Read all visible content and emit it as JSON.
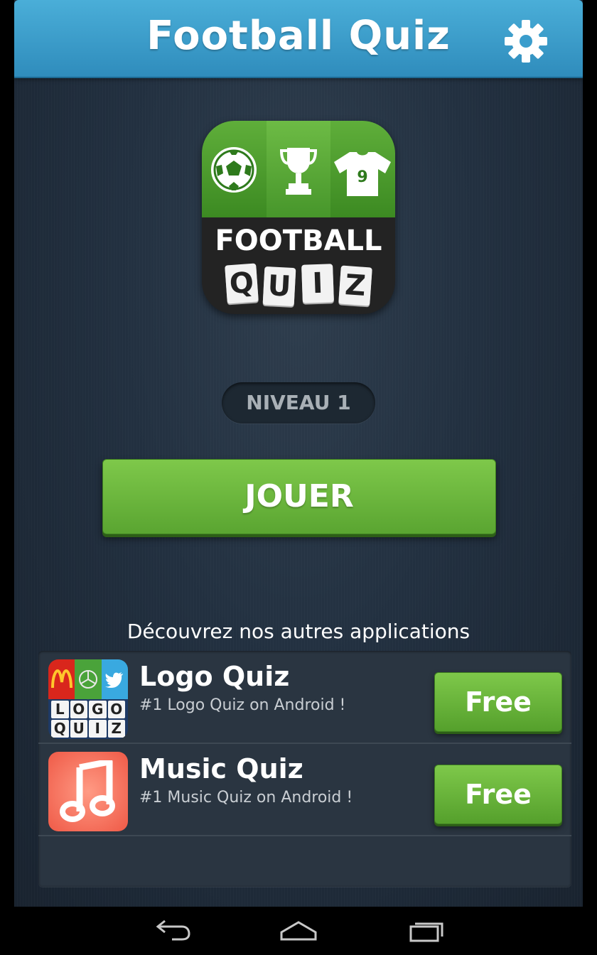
{
  "header": {
    "title": "Football Quiz"
  },
  "main_icon": {
    "word": "FOOTBALL",
    "tiles": [
      "Q",
      "U",
      "I",
      "Z"
    ],
    "jersey_number": "9"
  },
  "level": {
    "label": "NIVEAU 1"
  },
  "play_button": {
    "label": "JOUER"
  },
  "discover": {
    "title": "Découvrez nos autres applications"
  },
  "apps": [
    {
      "name": "Logo Quiz",
      "description": "#1 Logo Quiz on Android !",
      "button": "Free",
      "icon": "logo-quiz-icon",
      "icon_letters": [
        "L",
        "O",
        "G",
        "O",
        "Q",
        "U",
        "I",
        "Z"
      ]
    },
    {
      "name": "Music Quiz",
      "description": "#1 Music Quiz on Android !",
      "button": "Free",
      "icon": "music-quiz-icon"
    }
  ],
  "colors": {
    "header": "#3a9dcc",
    "play_button": "#6db83e",
    "background": "#223040",
    "free_button": "#6ab83c"
  }
}
